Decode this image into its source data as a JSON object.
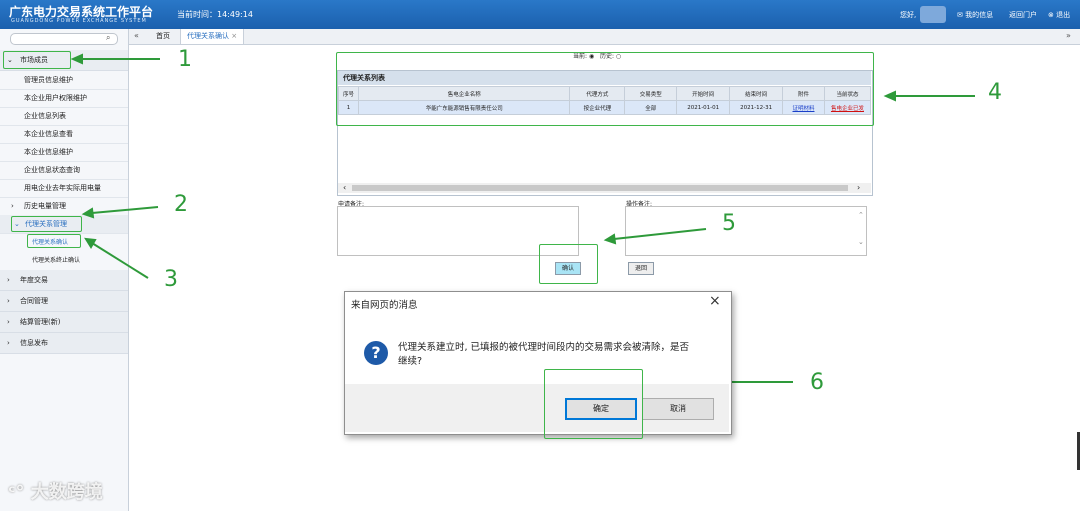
{
  "header": {
    "title": "广东电力交易系统工作平台",
    "subtitle": "GUANGDONG POWER EXCHANGE SYSTEM",
    "time_label": "当前时间：14:49:14",
    "greeting": "您好,",
    "links": [
      "我的信息",
      "返回门户",
      "退出"
    ]
  },
  "tabs": {
    "home": "首页",
    "active": "代理关系确认",
    "close": "×"
  },
  "sidebar": {
    "sections": [
      {
        "label": "市场成员",
        "items": [
          "管理员信息维护",
          "本企业用户权限维护",
          "企业信息列表",
          "本企业信息查看",
          "本企业信息维护",
          "企业信息状态查询",
          "用电企业去年实际用电量"
        ]
      },
      {
        "label": "历史电量管理"
      },
      {
        "label": "代理关系管理",
        "items": [
          "代理关系确认",
          "代理关系终止确认"
        ]
      },
      {
        "label": "年度交易"
      },
      {
        "label": "合同管理"
      },
      {
        "label": "结算管理(新)"
      },
      {
        "label": "信息发布"
      }
    ]
  },
  "filter": {
    "current": "当前:",
    "history": "历史:"
  },
  "list": {
    "title": "代理关系列表",
    "columns": [
      "序号",
      "售电企业名称",
      "代理方式",
      "交易类型",
      "开始时间",
      "结束时间",
      "附件",
      "当前状态"
    ],
    "rows": [
      [
        "1",
        "华能广东能源销售有限责任公司",
        "按企业代理",
        "全部",
        "2021-01-01",
        "2021-12-31",
        "证明材料",
        "售电企业已发"
      ]
    ]
  },
  "form": {
    "apply_note_label": "申请备注:",
    "op_note_label": "操作备注:",
    "confirm": "确认",
    "back": "退回"
  },
  "dialog": {
    "title": "来自网页的消息",
    "close": "×",
    "message": "代理关系建立时, 已填报的被代理时间段内的交易需求会被清除，是否继续?",
    "ok": "确定",
    "cancel": "取消"
  },
  "annotations": [
    "1",
    "2",
    "3",
    "4",
    "5",
    "6"
  ],
  "watermark": "大数跨境",
  "colors": {
    "header": "#1f66b4",
    "annotation": "#2e9a3a",
    "link": "#1a3fc8",
    "status": "#d01010"
  }
}
